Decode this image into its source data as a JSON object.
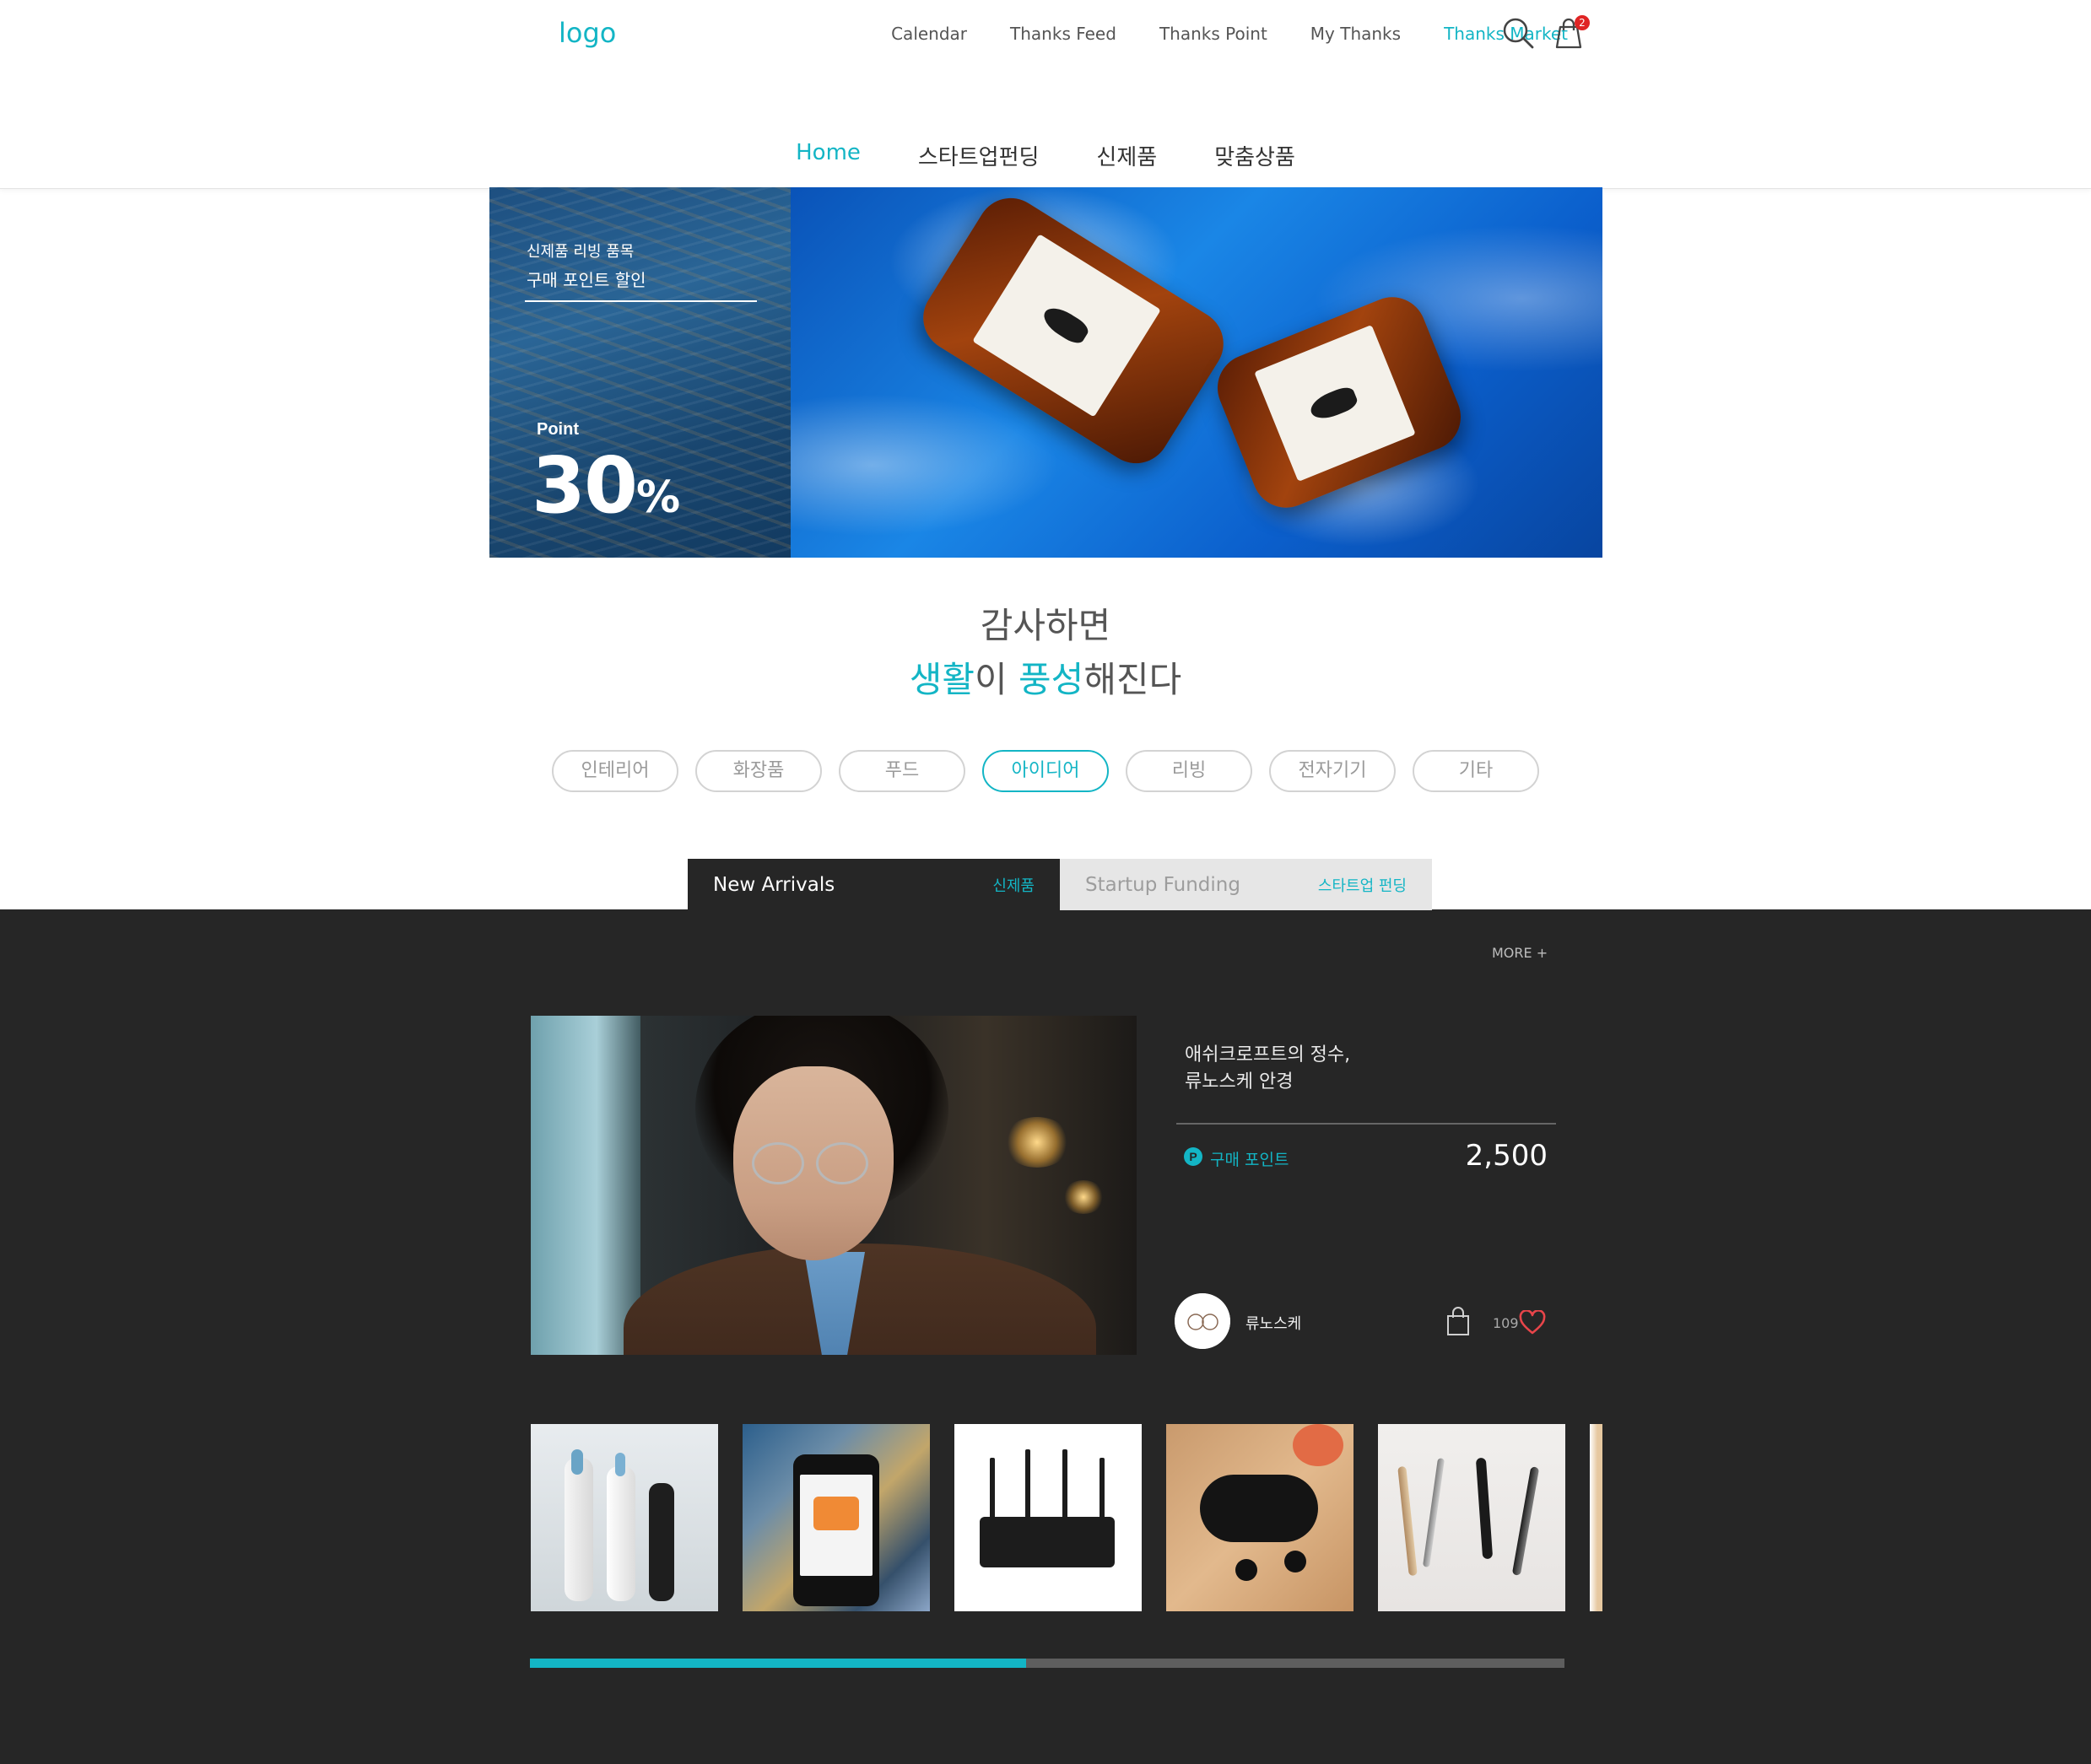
{
  "header": {
    "logo": "logo",
    "nav": [
      {
        "label": "Calendar",
        "active": false
      },
      {
        "label": "Thanks Feed",
        "active": false
      },
      {
        "label": "Thanks Point",
        "active": false
      },
      {
        "label": "My Thanks",
        "active": false
      },
      {
        "label": "Thanks Market",
        "active": true
      }
    ],
    "cart_badge": "2",
    "icons": [
      "search-icon",
      "cart-icon"
    ]
  },
  "subnav": {
    "tabs": [
      {
        "label": "Home",
        "active": true
      },
      {
        "label": "스타트업펀딩",
        "active": false
      },
      {
        "label": "신제품",
        "active": false
      },
      {
        "label": "맞춤상품",
        "active": false
      }
    ]
  },
  "hero": {
    "line1": "신제품 리빙 품목",
    "line2": "구매 포인트 할인",
    "point_label": "Point",
    "percent": "30",
    "percent_symbol": "%"
  },
  "tagline": {
    "line1": "감사하면",
    "w1": "생활",
    "w2": "이 ",
    "w3": "풍성",
    "w4": "해진다"
  },
  "categories": [
    {
      "label": "인테리어",
      "active": false
    },
    {
      "label": "화장품",
      "active": false
    },
    {
      "label": "푸드",
      "active": false
    },
    {
      "label": "아이디어",
      "active": true
    },
    {
      "label": "리빙",
      "active": false
    },
    {
      "label": "전자기기",
      "active": false
    },
    {
      "label": "기타",
      "active": false
    }
  ],
  "section_tabs": [
    {
      "en": "New Arrivals",
      "ko": "신제품",
      "active": true
    },
    {
      "en": "Startup Funding",
      "ko": "스타트업 펀딩",
      "active": false
    }
  ],
  "more_label": "MORE +",
  "featured": {
    "title_line1": "애쉬크로프트의 정수,",
    "title_line2": "류노스케 안경",
    "point_icon": "P",
    "point_label": "구매 포인트",
    "point_value": "2,500",
    "brand": "류노스케",
    "likes": "109"
  },
  "carousel": {
    "items": [
      "toothbrushes",
      "phone-photo-collage",
      "wifi-router",
      "wireless-earbuds",
      "grooming-tools"
    ],
    "progress": 0.48
  },
  "colors": {
    "accent": "#13b5c5",
    "dark_bg": "#262626",
    "badge": "#e02424",
    "heart": "#e8454a"
  }
}
